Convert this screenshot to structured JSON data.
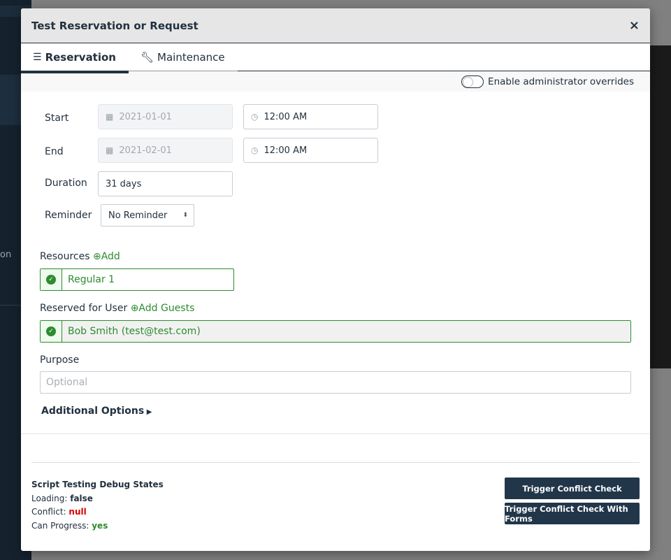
{
  "background": {
    "sidebar_text": "on"
  },
  "modal": {
    "title": "Test Reservation or Request",
    "close_label": "×",
    "tabs": [
      {
        "label": "Reservation",
        "icon": "list-check-icon",
        "active": true
      },
      {
        "label": "Maintenance",
        "icon": "wrench-icon",
        "active": false
      }
    ],
    "admin_override": {
      "label": "Enable administrator overrides",
      "enabled": false
    }
  },
  "form": {
    "start": {
      "label": "Start",
      "date": "2021-01-01",
      "time": "12:00 AM"
    },
    "end": {
      "label": "End",
      "date": "2021-02-01",
      "time": "12:00 AM"
    },
    "duration": {
      "label": "Duration",
      "value": "31 days"
    },
    "reminder": {
      "label": "Reminder",
      "value": "No Reminder"
    },
    "resources": {
      "label": "Resources",
      "add_label": "Add",
      "items": [
        "Regular 1"
      ]
    },
    "reserved_for": {
      "label": "Reserved for User",
      "add_label": "Add Guests",
      "value": "Bob Smith (test@test.com)"
    },
    "purpose": {
      "label": "Purpose",
      "placeholder": "Optional"
    },
    "additional_options": "Additional Options"
  },
  "debug": {
    "title": "Script Testing Debug States",
    "loading_label": "Loading:",
    "loading_value": "false",
    "conflict_label": "Conflict:",
    "conflict_value": "null",
    "progress_label": "Can Progress:",
    "progress_value": "yes"
  },
  "buttons": {
    "conflict_check": "Trigger Conflict Check",
    "conflict_check_forms": "Trigger Conflict Check With Forms"
  },
  "colors": {
    "primary": "#22364a",
    "success": "#2e8b30",
    "danger": "#d40000"
  }
}
